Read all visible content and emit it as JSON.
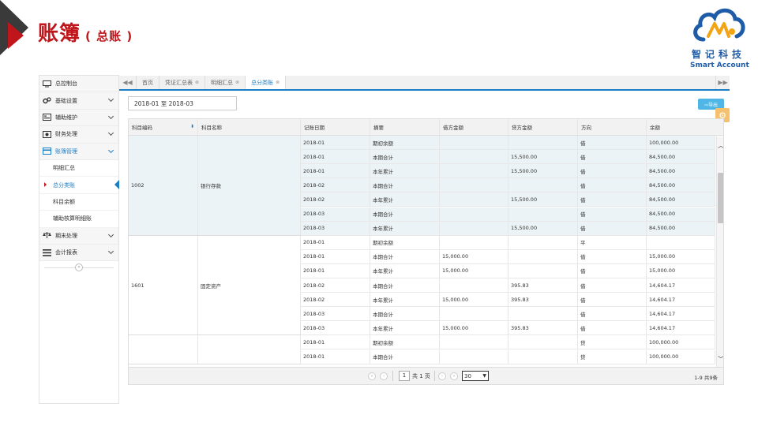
{
  "slide": {
    "title": "账簿",
    "subtitle": "( 总账 )"
  },
  "logo": {
    "brand_cn": "智记科技",
    "brand_en": "Smart Account"
  },
  "sidebar": {
    "items": [
      {
        "label": "总控制台",
        "icon": "monitor-icon"
      },
      {
        "label": "基础设置",
        "icon": "gears-icon"
      },
      {
        "label": "辅助维护",
        "icon": "list-card-icon"
      },
      {
        "label": "财务处理",
        "icon": "finance-icon"
      },
      {
        "label": "账簿管理",
        "icon": "book-icon"
      },
      {
        "label": "期末处理",
        "icon": "scale-icon"
      },
      {
        "label": "会计报表",
        "icon": "report-list-icon"
      }
    ],
    "subitems": [
      "明细汇总",
      "总分类账",
      "科目余额",
      "辅助核算明细账"
    ]
  },
  "tabs": {
    "items": [
      {
        "label": "首页"
      },
      {
        "label": "凭证汇总表"
      },
      {
        "label": "明细汇总"
      },
      {
        "label": "总分类账"
      }
    ]
  },
  "filter": {
    "date_range": "2018-01 至 2018-03"
  },
  "toolbar": {
    "export_label": "⇨导出"
  },
  "table": {
    "headers": [
      "科目编码",
      "科目名称",
      "记账日期",
      "摘要",
      "借方金额",
      "贷方金额",
      "方向",
      "余额"
    ],
    "groups": [
      {
        "code": "1002",
        "name": "银行存款",
        "rows": [
          [
            "2018-01",
            "期初余额",
            "",
            "",
            "借",
            "100,000.00"
          ],
          [
            "2018-01",
            "本期合计",
            "",
            "15,500.00",
            "借",
            "84,500.00"
          ],
          [
            "2018-01",
            "本年累计",
            "",
            "15,500.00",
            "借",
            "84,500.00"
          ],
          [
            "2018-02",
            "本期合计",
            "",
            "",
            "借",
            "84,500.00"
          ],
          [
            "2018-02",
            "本年累计",
            "",
            "15,500.00",
            "借",
            "84,500.00"
          ],
          [
            "2018-03",
            "本期合计",
            "",
            "",
            "借",
            "84,500.00"
          ],
          [
            "2018-03",
            "本年累计",
            "",
            "15,500.00",
            "借",
            "84,500.00"
          ]
        ]
      },
      {
        "code": "1601",
        "name": "固定资产",
        "rows": [
          [
            "2018-01",
            "期初余额",
            "",
            "",
            "平",
            ""
          ],
          [
            "2018-01",
            "本期合计",
            "15,000.00",
            "",
            "借",
            "15,000.00"
          ],
          [
            "2018-01",
            "本年累计",
            "15,000.00",
            "",
            "借",
            "15,000.00"
          ],
          [
            "2018-02",
            "本期合计",
            "",
            "395.83",
            "借",
            "14,604.17"
          ],
          [
            "2018-02",
            "本年累计",
            "15,000.00",
            "395.83",
            "借",
            "14,604.17"
          ],
          [
            "2018-03",
            "本期合计",
            "",
            "",
            "借",
            "14,604.17"
          ],
          [
            "2018-03",
            "本年累计",
            "15,000.00",
            "395.83",
            "借",
            "14,604.17"
          ]
        ]
      },
      {
        "code": "",
        "name": "",
        "rows": [
          [
            "2018-01",
            "期初余额",
            "",
            "",
            "贷",
            "100,000.00"
          ],
          [
            "2018-01",
            "本期合计",
            "",
            "",
            "贷",
            "100,000.00"
          ]
        ]
      }
    ]
  },
  "pager": {
    "current_page": "1",
    "total_pages": "共 1 页",
    "page_size": "30",
    "info": "1-9 共9条"
  },
  "colors": {
    "accent": "#1b7ec4",
    "title_red": "#c0161b",
    "row_highlight": "#ecf3f6"
  }
}
